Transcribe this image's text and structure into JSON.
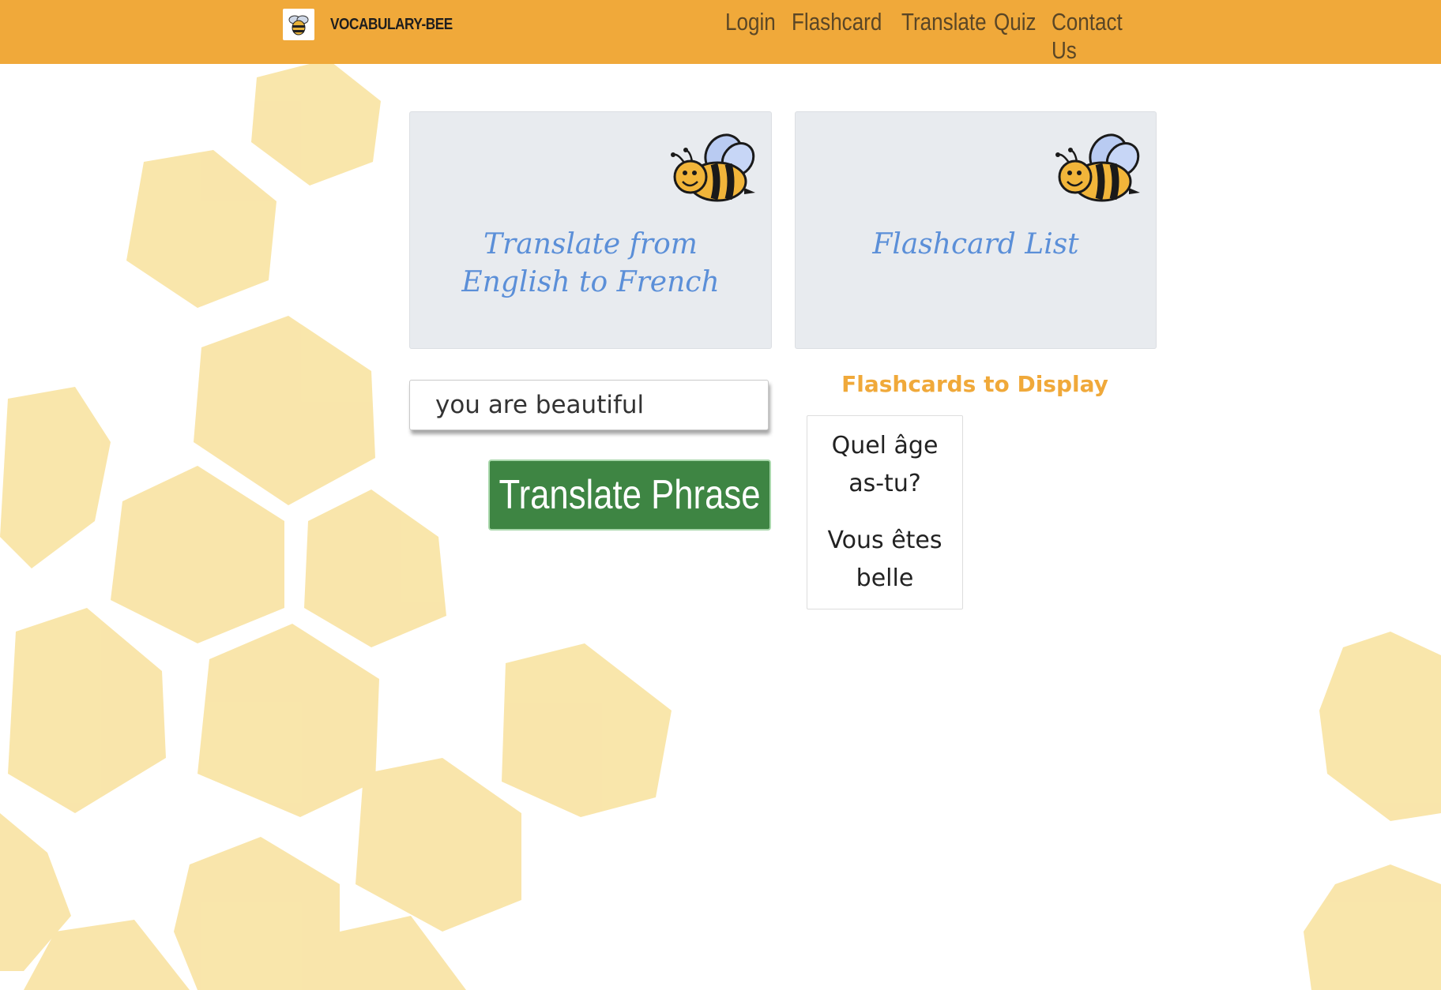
{
  "navbar": {
    "brand": "VOCABULARY-BEE",
    "links": [
      "Login",
      "Flashcard",
      "Translate",
      "Quiz",
      "Contact Us"
    ]
  },
  "cards": {
    "translate_title": "Translate from English to French",
    "flashcard_title": "Flashcard List"
  },
  "translate": {
    "input_value": "you are beautiful",
    "button_label": "Translate Phrase"
  },
  "flashcards": {
    "heading": "Flashcards to Display",
    "items": [
      "Quel âge as-tu?",
      "Vous êtes belle"
    ]
  },
  "colors": {
    "navbar": "#f0a93a",
    "button": "#3e8543",
    "card_title": "#5b8fd8",
    "heading": "#f0a93a"
  }
}
